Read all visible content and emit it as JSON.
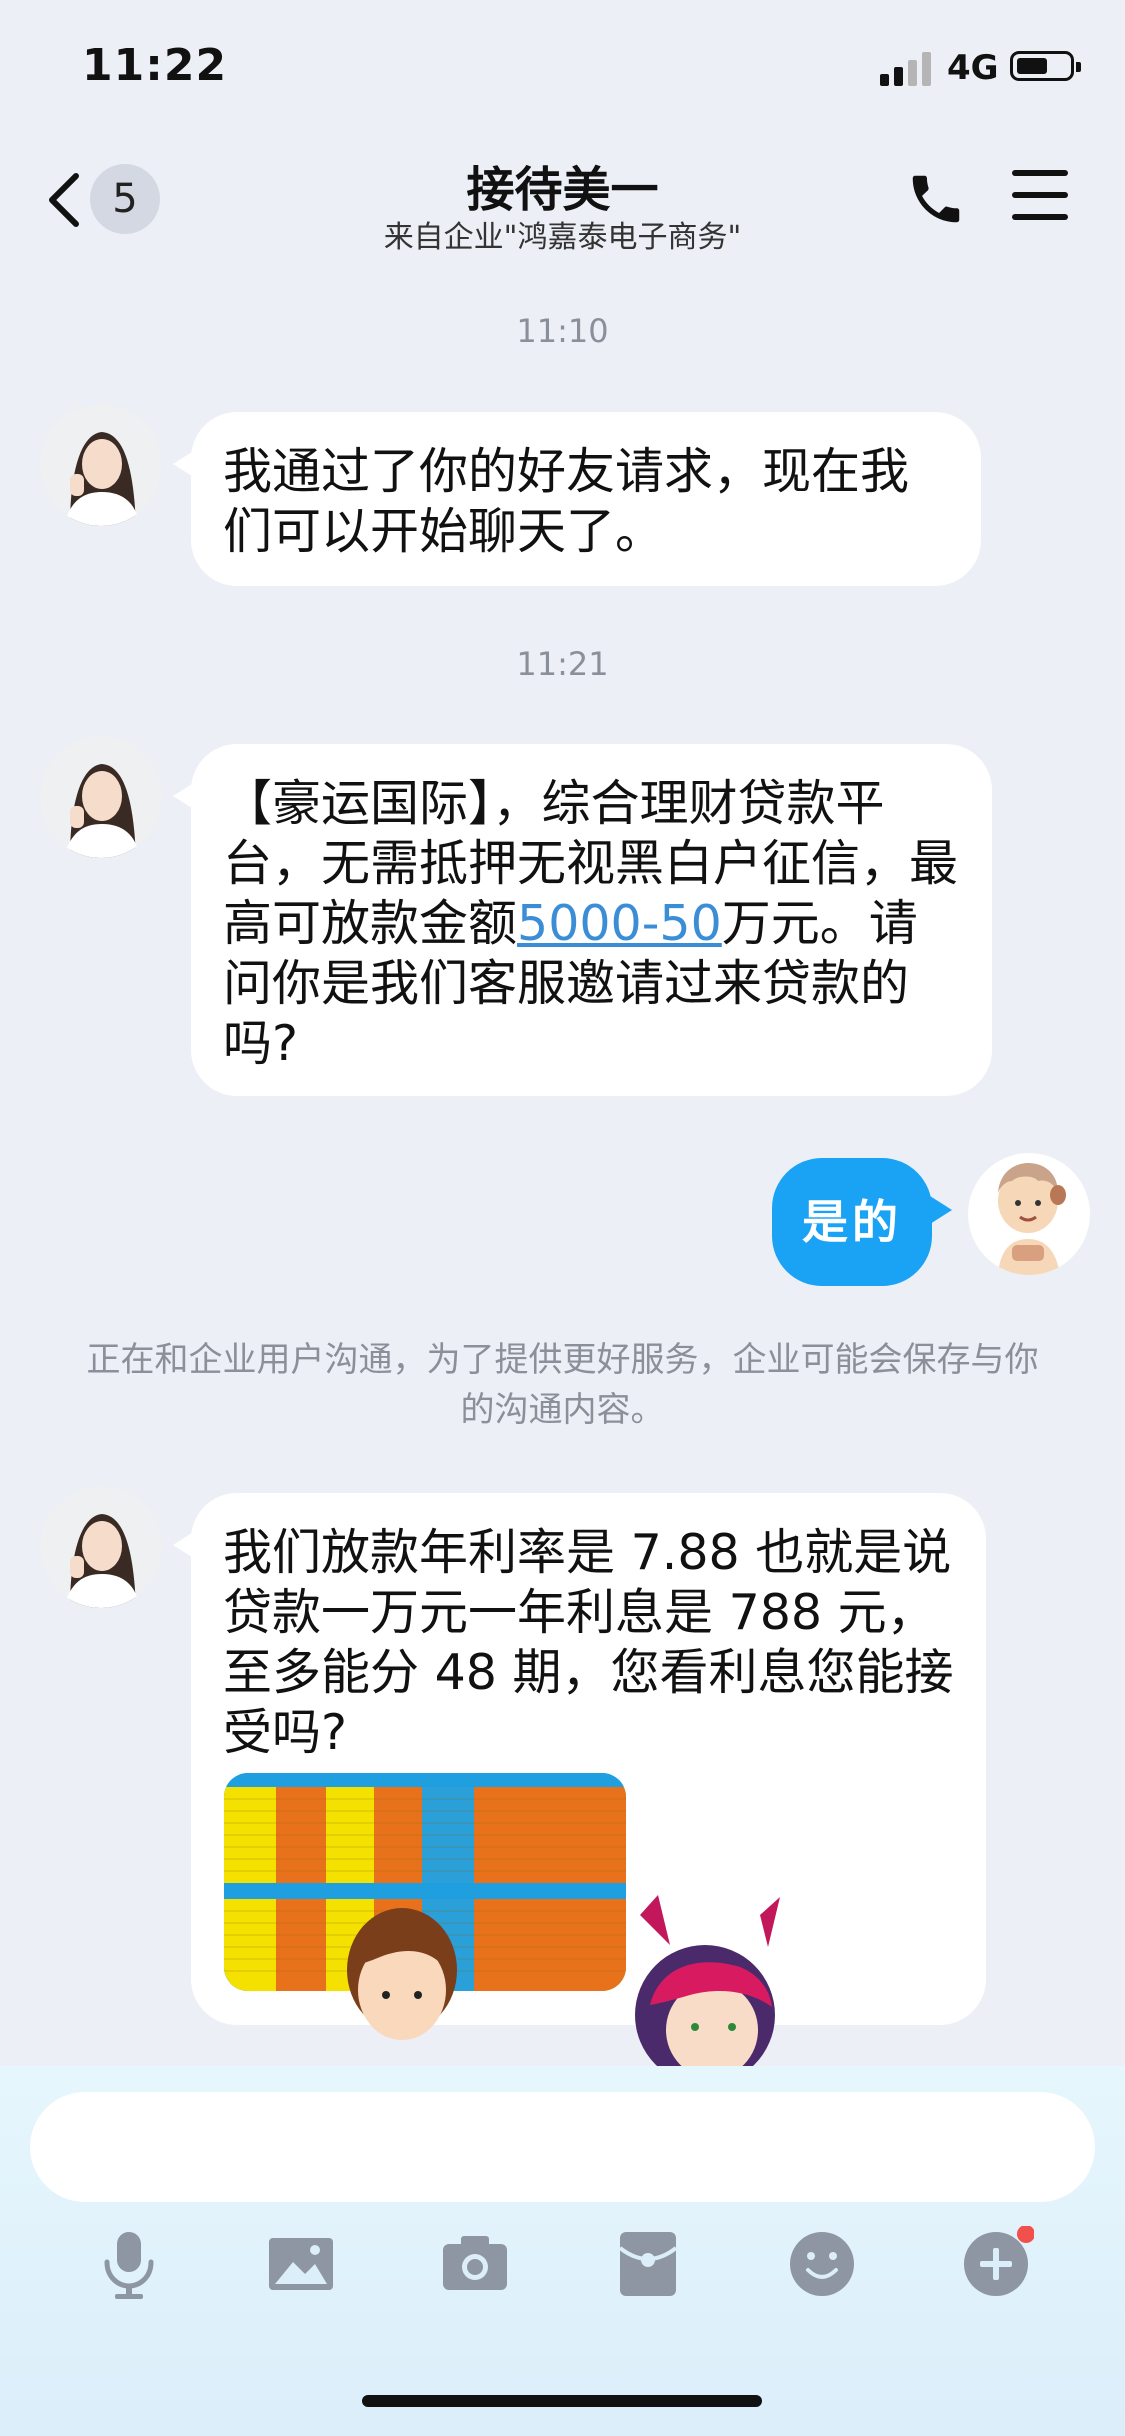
{
  "status_bar": {
    "time": "11:22",
    "network": "4G"
  },
  "header": {
    "unread_count": "5",
    "title": "接待美一",
    "subtitle": "来自企业\"鸿嘉泰电子商务\""
  },
  "chat": {
    "timestamps": [
      "11:10",
      "11:21"
    ],
    "msg1": "我通过了你的好友请求，现在我们可以开始聊天了。",
    "msg2": {
      "before": "【豪运国际】，综合理财贷款平台，无需抵押无视黑白户征信，最高可放款金额",
      "link": "5000-50",
      "after": "万元。请问你是我们客服邀请过来贷款的吗?"
    },
    "reply": "是的",
    "system_notice": "正在和企业用户沟通，为了提供更好服务，企业可能会保存与你的沟通内容。",
    "msg3": "我们放款年利率是 7.88 也就是说贷款一万元一年利息是 788 元，至多能分 48 期，您看利息您能接受吗?"
  },
  "toolbar": {
    "icons": [
      "microphone-icon",
      "image-icon",
      "camera-icon",
      "red-packet-icon",
      "emoji-icon",
      "plus-icon"
    ],
    "notification_color": "#f2504b"
  },
  "colors": {
    "accent": "#1aa3f5",
    "link": "#3b8ed6",
    "background": "#eceff6"
  }
}
